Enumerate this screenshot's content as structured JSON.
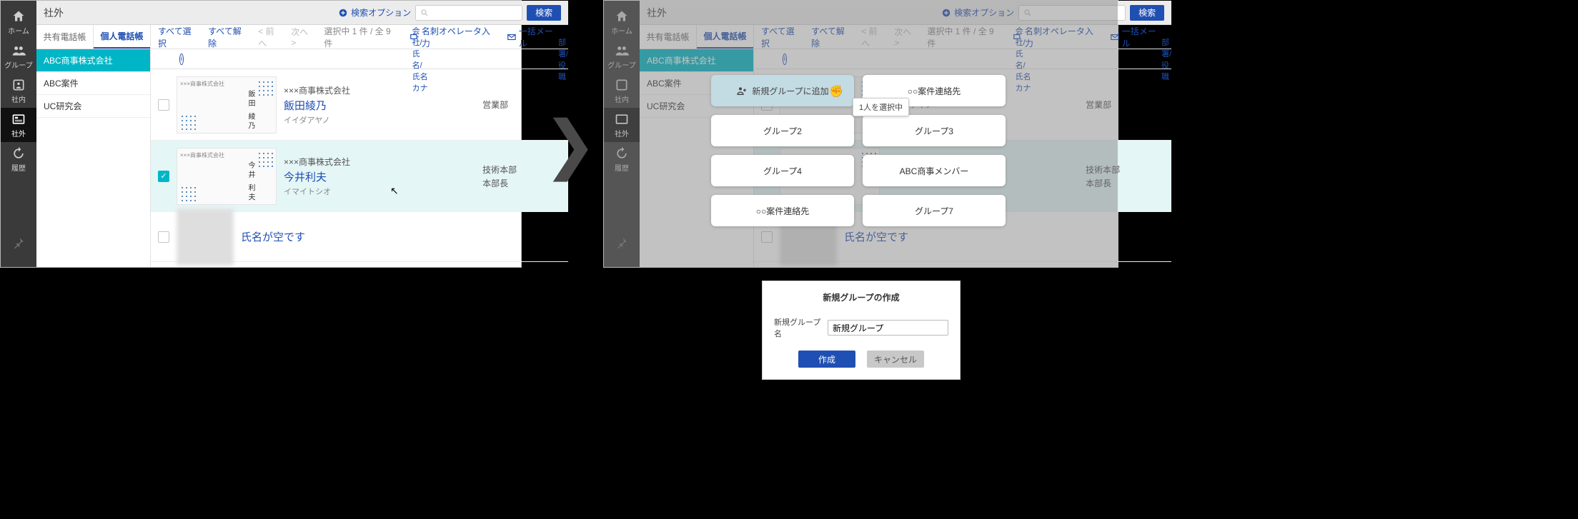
{
  "sidebar": {
    "items": [
      {
        "label": "ホーム"
      },
      {
        "label": "グループ"
      },
      {
        "label": "社内"
      },
      {
        "label": "社外"
      },
      {
        "label": "履歴"
      }
    ]
  },
  "topbar": {
    "breadcrumb": "社外",
    "search_option": "検索オプション",
    "search_button": "検索"
  },
  "book_tabs": {
    "shared": "共有電話帳",
    "personal": "個人電話帳"
  },
  "groups": [
    "ABC商事株式会社",
    "ABC案件",
    "UC研究会"
  ],
  "list_toolbar": {
    "select_all": "すべて選択",
    "deselect_all": "すべて解除",
    "prev": "< 前へ",
    "next": "次へ >",
    "count": "選択中 1 件 / 全 9 件",
    "operator": "名刺オペレータ入力",
    "bulk_mail": "一括メール"
  },
  "list_header": {
    "company_name": "会社/氏名/氏名カナ",
    "dept": "部署/役職"
  },
  "rows": [
    {
      "company": "×××商事株式会社",
      "name": "飯田綾乃",
      "kana": "イイダアヤノ",
      "dept": "営業部",
      "title": "",
      "card_company": "×××商事株式会社",
      "vname": "飯田 綾乃",
      "checked": false
    },
    {
      "company": "×××商事株式会社",
      "name": "今井利夫",
      "kana": "イマイトシオ",
      "dept": "技術本部",
      "title": "本部長",
      "card_company": "×××商事株式会社",
      "vname": "今井 利夫",
      "checked": true
    },
    {
      "company": "",
      "name": "氏名が空です",
      "kana": "",
      "dept": "",
      "title": "",
      "checked": false,
      "blur": true
    }
  ],
  "picker": {
    "new_group": "新規グループに追加",
    "selecting": "1人を選択中",
    "options": [
      "○○案件連絡先",
      "グループ2",
      "グループ3",
      "グループ4",
      "ABC商事メンバー",
      "○○案件連絡先",
      "グループ7"
    ]
  },
  "dialog": {
    "title": "新規グループの作成",
    "label": "新規グループ名",
    "value": "新規グループ",
    "create": "作成",
    "cancel": "キャンセル"
  }
}
